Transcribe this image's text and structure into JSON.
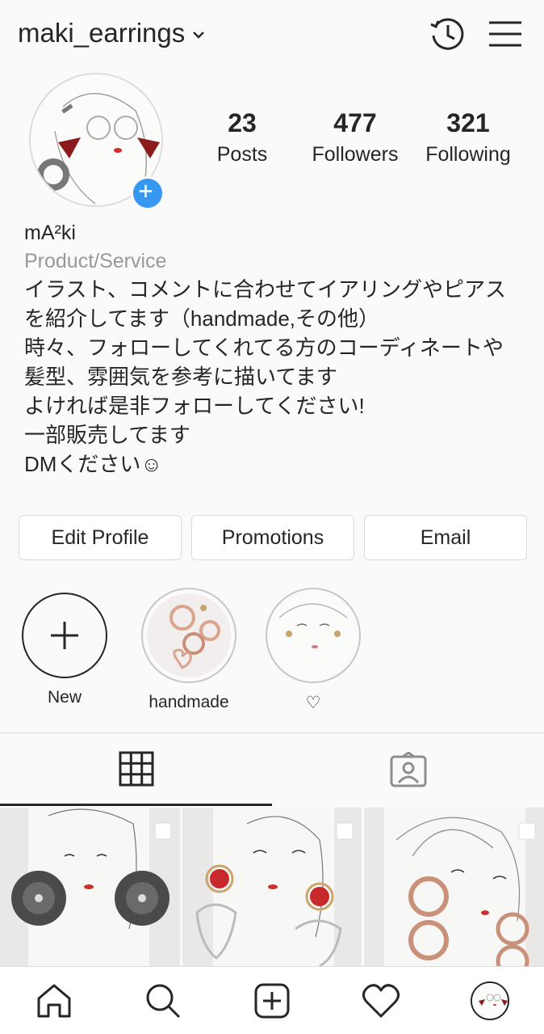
{
  "header": {
    "username": "maki_earrings",
    "icons": [
      "chevron-down-icon",
      "history-icon",
      "menu-icon"
    ]
  },
  "profile": {
    "stats": [
      {
        "value": "23",
        "label": "Posts"
      },
      {
        "value": "477",
        "label": "Followers"
      },
      {
        "value": "321",
        "label": "Following"
      }
    ]
  },
  "bio": {
    "name": "mA²ki",
    "category": "Product/Service",
    "lines": [
      "イラスト、コメントに合わせてイアリングやピアス",
      "を紹介してます（handmade,その他）",
      "時々、フォローしてくれてる方のコーディネートや",
      "髪型、雰囲気を参考に描いてます",
      "よければ是非フォローしてください!",
      "一部販売してます",
      "DMください☺"
    ]
  },
  "buttons": {
    "edit": "Edit Profile",
    "promotions": "Promotions",
    "email": "Email"
  },
  "highlights": [
    {
      "label": "New"
    },
    {
      "label": "handmade"
    },
    {
      "label": "♡"
    }
  ],
  "tabs": [
    "grid-icon",
    "tagged-icon"
  ],
  "nav": [
    "home-icon",
    "search-icon",
    "add-post-icon",
    "heart-icon",
    "profile-avatar"
  ],
  "colors": {
    "accent": "#3897f0",
    "text": "#262626",
    "muted": "#999999",
    "border": "#dbdbdb",
    "background": "#fafafa"
  }
}
